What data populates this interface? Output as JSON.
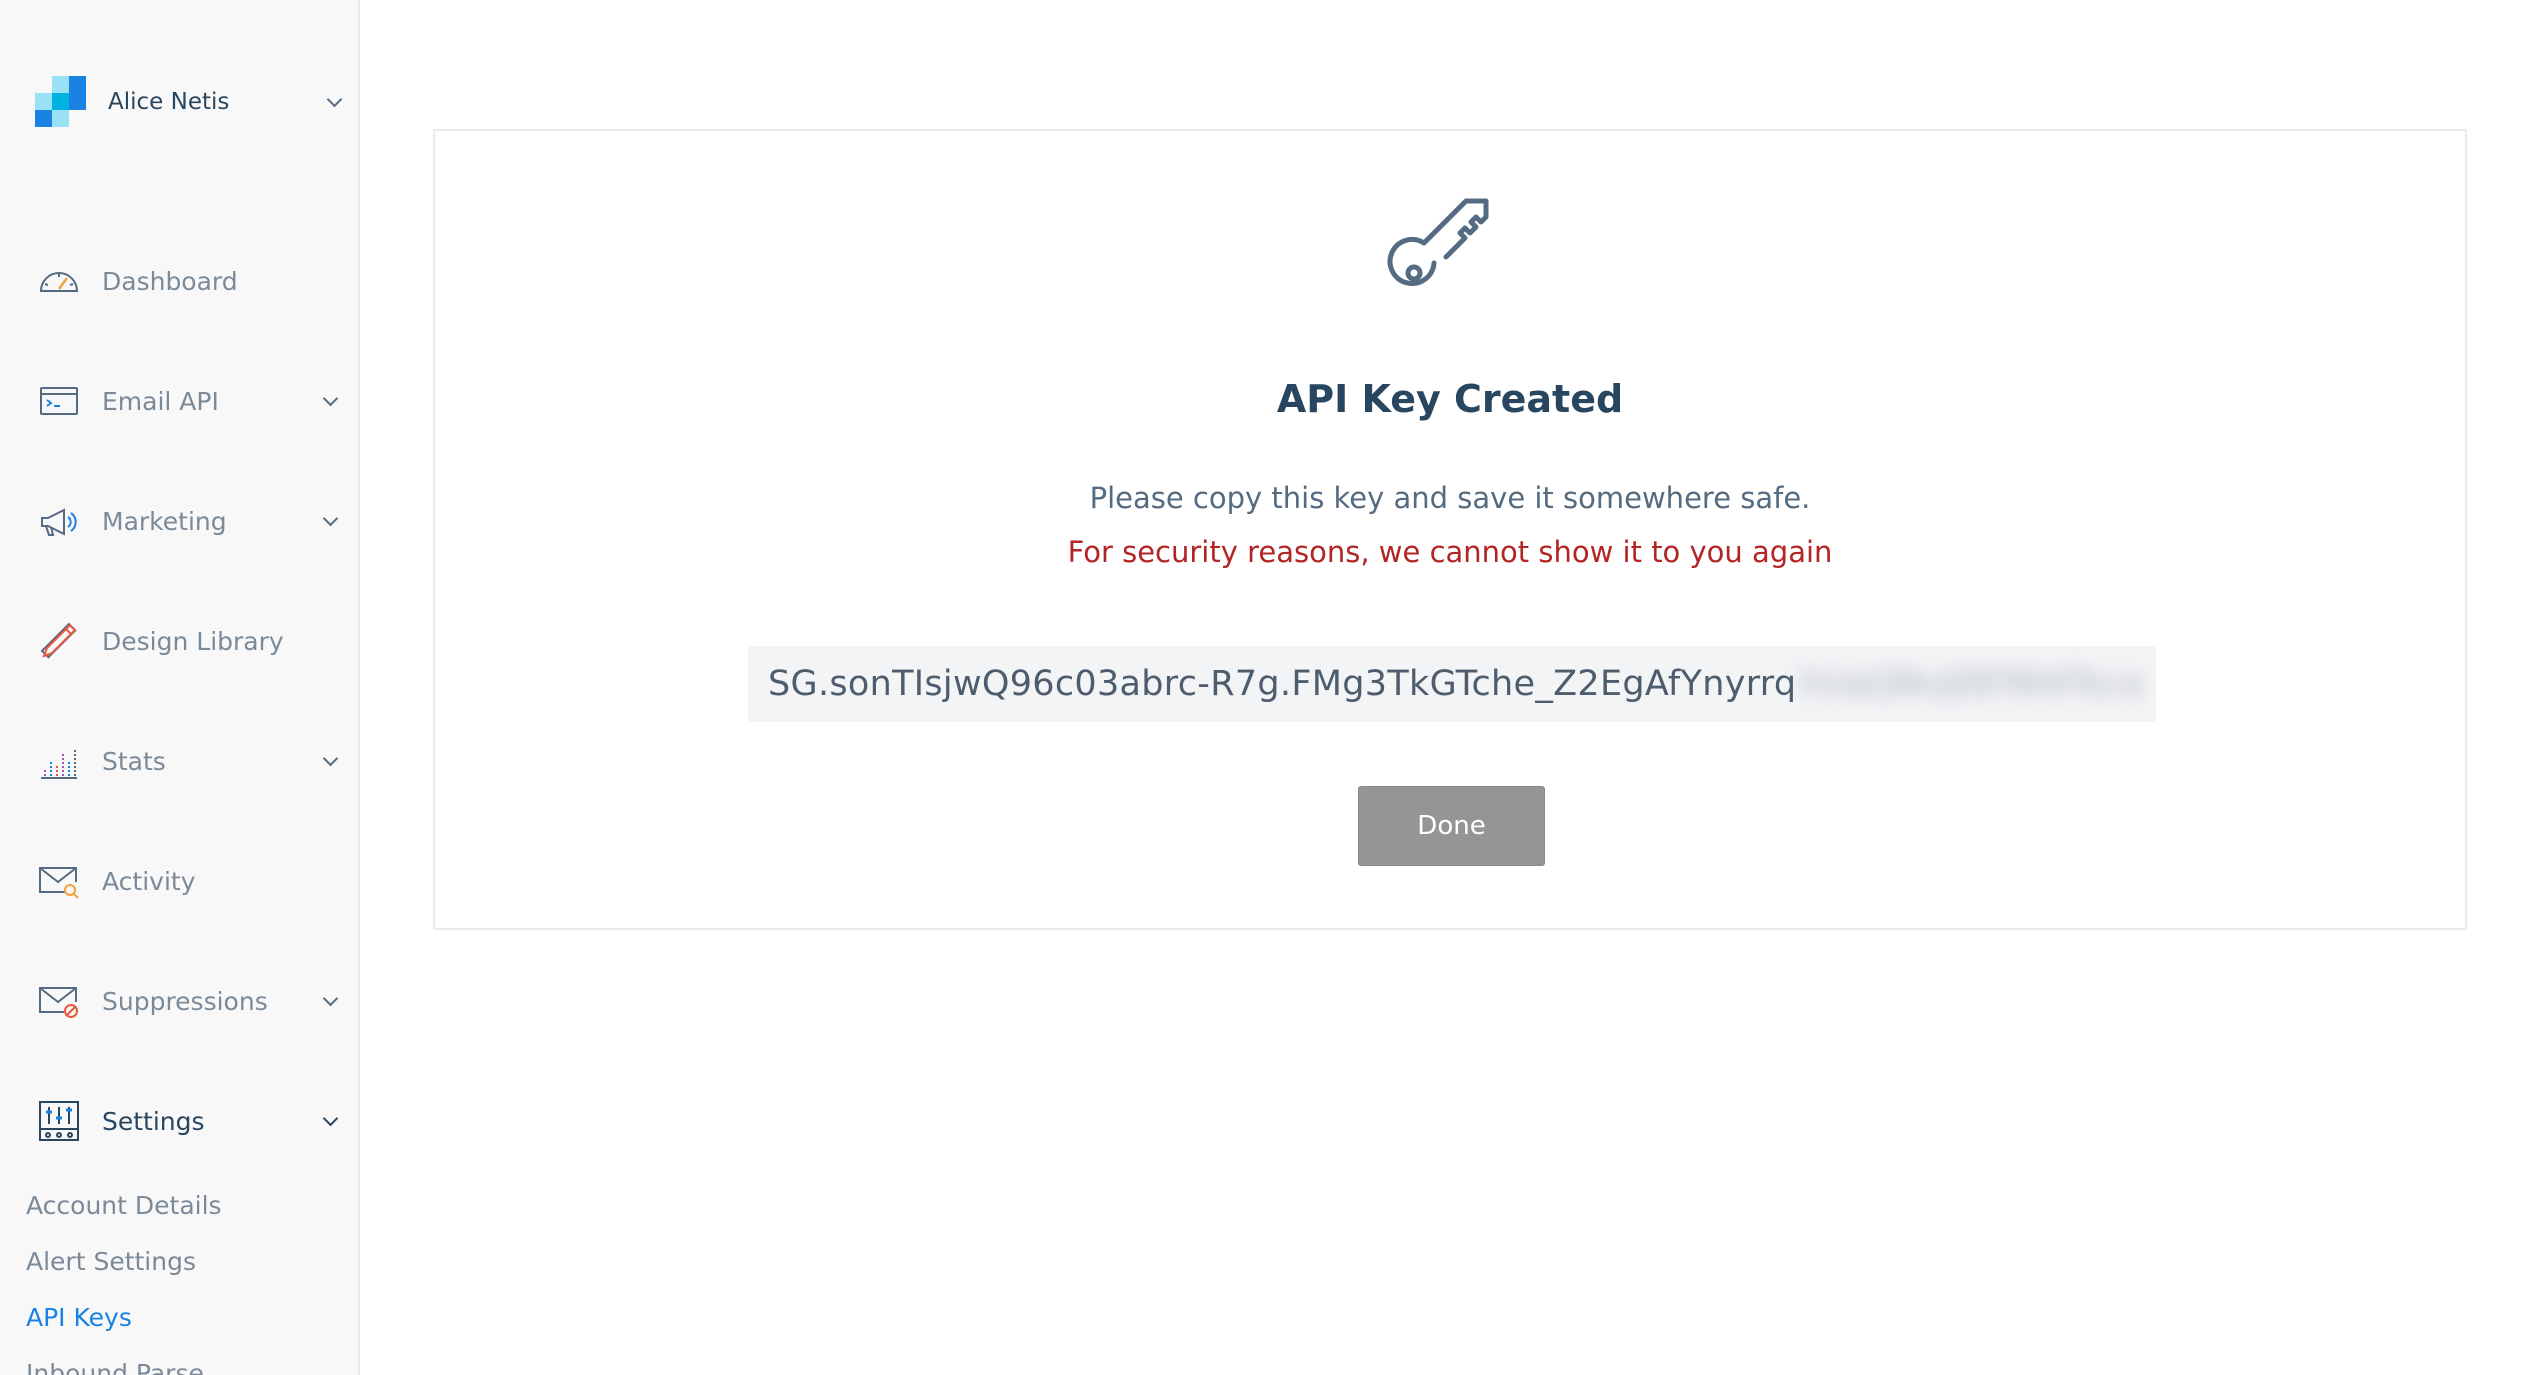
{
  "colors": {
    "sidebar_bg": "#f8f8f8",
    "text_primary": "#294661",
    "text_muted": "#7b8a99",
    "link_active": "#1a82e2",
    "warning": "#b32424",
    "button_bg": "#959595",
    "logo_blue": "#1a82e2",
    "logo_light_blue": "#99e1f4",
    "logo_mid_blue": "#00b3e3"
  },
  "account": {
    "name": "Alice Netis",
    "logo_icon": "sendgrid-logo-icon"
  },
  "sidebar": {
    "items": [
      {
        "label": "Dashboard",
        "icon": "dashboard-gauge-icon"
      },
      {
        "label": "Email API",
        "icon": "terminal-window-icon"
      },
      {
        "label": "Marketing",
        "icon": "megaphone-icon"
      },
      {
        "label": "Design Library",
        "icon": "pencil-ruler-icon"
      },
      {
        "label": "Stats",
        "icon": "bar-stats-icon"
      },
      {
        "label": "Activity",
        "icon": "envelope-search-icon"
      },
      {
        "label": "Suppressions",
        "icon": "envelope-block-icon"
      },
      {
        "label": "Settings",
        "icon": "sliders-settings-icon"
      }
    ],
    "settings_subnav": [
      {
        "label": "Account Details"
      },
      {
        "label": "Alert Settings"
      },
      {
        "label": "API Keys"
      },
      {
        "label": "Inbound Parse"
      }
    ]
  },
  "card": {
    "icon": "key-icon",
    "title": "API Key Created",
    "subtitle": "Please copy this key and save it somewhere safe.",
    "warning": "For security reasons, we cannot show it to you again",
    "api_key_visible": "SG.sonTIsjwQ96c03abrc-R7g.FMg3TkGTche_Z2EgAfYnyrrq",
    "api_key_blurred": "hUaQNvJ0EfW4Tsca",
    "done_label": "Done"
  }
}
